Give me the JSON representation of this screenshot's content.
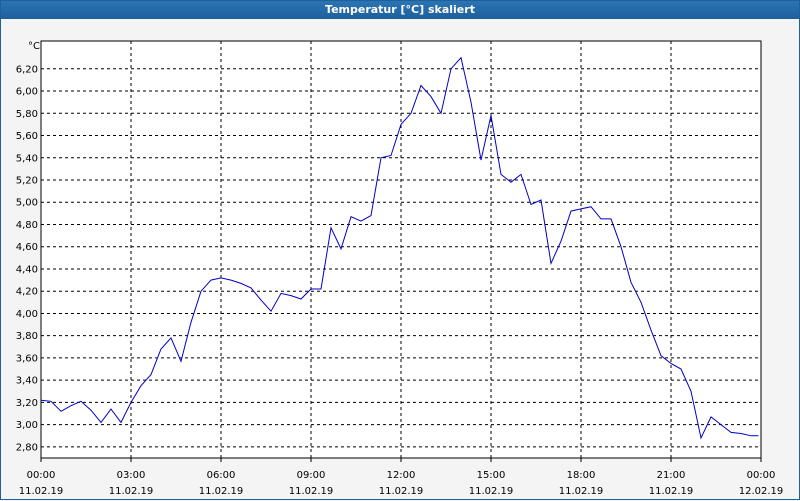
{
  "window": {
    "title": "Temperatur [°C] skaliert"
  },
  "chart_data": {
    "type": "line",
    "title": "Temperatur [°C] skaliert",
    "ylabel": "°C",
    "xlabel": "",
    "ylim": [
      2.7,
      6.45
    ],
    "xlim_hours": [
      0,
      24
    ],
    "grid": true,
    "grid_style": "dashed",
    "y_ticks": [
      "2,80",
      "3,00",
      "3,20",
      "3,40",
      "3,60",
      "3,80",
      "4,00",
      "4,20",
      "4,40",
      "4,60",
      "4,80",
      "5,00",
      "5,20",
      "5,40",
      "5,60",
      "5,80",
      "6,00",
      "6,20"
    ],
    "x_ticks": [
      {
        "time": "00:00",
        "date": "11.02.19"
      },
      {
        "time": "03:00",
        "date": "11.02.19"
      },
      {
        "time": "06:00",
        "date": "11.02.19"
      },
      {
        "time": "09:00",
        "date": "11.02.19"
      },
      {
        "time": "12:00",
        "date": "11.02.19"
      },
      {
        "time": "15:00",
        "date": "11.02.19"
      },
      {
        "time": "18:00",
        "date": "11.02.19"
      },
      {
        "time": "21:00",
        "date": "11.02.19"
      },
      {
        "time": "00:00",
        "date": "12.02.19"
      }
    ],
    "series": [
      {
        "color": "#0000c8",
        "x": [
          "11.02.19 00:00",
          "11.02.19 00:20",
          "11.02.19 00:40",
          "11.02.19 01:00",
          "11.02.19 01:20",
          "11.02.19 01:40",
          "11.02.19 02:00",
          "11.02.19 02:20",
          "11.02.19 02:40",
          "11.02.19 03:00",
          "11.02.19 03:20",
          "11.02.19 03:40",
          "11.02.19 04:00",
          "11.02.19 04:20",
          "11.02.19 04:40",
          "11.02.19 05:00",
          "11.02.19 05:20",
          "11.02.19 05:40",
          "11.02.19 06:00",
          "11.02.19 06:20",
          "11.02.19 06:40",
          "11.02.19 07:00",
          "11.02.19 07:20",
          "11.02.19 07:40",
          "11.02.19 08:00",
          "11.02.19 08:20",
          "11.02.19 08:40",
          "11.02.19 09:00",
          "11.02.19 09:20",
          "11.02.19 09:40",
          "11.02.19 10:00",
          "11.02.19 10:20",
          "11.02.19 10:40",
          "11.02.19 11:00",
          "11.02.19 11:20",
          "11.02.19 11:40",
          "11.02.19 12:00",
          "11.02.19 12:20",
          "11.02.19 12:40",
          "11.02.19 13:00",
          "11.02.19 13:20",
          "11.02.19 13:40",
          "11.02.19 14:00",
          "11.02.19 14:20",
          "11.02.19 14:40",
          "11.02.19 15:00",
          "11.02.19 15:20",
          "11.02.19 15:40",
          "11.02.19 16:00",
          "11.02.19 16:20",
          "11.02.19 16:40",
          "11.02.19 17:00",
          "11.02.19 17:20",
          "11.02.19 17:40",
          "11.02.19 18:00",
          "11.02.19 18:20",
          "11.02.19 18:40",
          "11.02.19 19:00",
          "11.02.19 19:20",
          "11.02.19 19:40",
          "11.02.19 20:00",
          "11.02.19 20:20",
          "11.02.19 20:40",
          "11.02.19 21:00",
          "11.02.19 21:20",
          "11.02.19 21:40",
          "11.02.19 22:00",
          "11.02.19 22:20",
          "11.02.19 22:40",
          "11.02.19 23:00",
          "11.02.19 23:20",
          "11.02.19 23:40",
          "11.02.19 23:55"
        ],
        "y": [
          3.22,
          3.21,
          3.12,
          3.17,
          3.21,
          3.13,
          3.02,
          3.14,
          3.02,
          3.2,
          3.35,
          3.45,
          3.68,
          3.78,
          3.57,
          3.92,
          4.2,
          4.3,
          4.32,
          4.3,
          4.27,
          4.23,
          4.12,
          4.02,
          4.18,
          4.16,
          4.13,
          4.22,
          4.22,
          4.77,
          4.58,
          4.87,
          4.83,
          4.88,
          5.4,
          5.42,
          5.7,
          5.8,
          6.05,
          5.95,
          5.8,
          6.2,
          6.3,
          5.9,
          5.38,
          5.78,
          5.25,
          5.18,
          5.25,
          4.98,
          5.02,
          4.45,
          4.65,
          4.92,
          4.94,
          4.96,
          4.85,
          4.85,
          4.6,
          4.28,
          4.1,
          3.85,
          3.62,
          3.55,
          3.5,
          3.3,
          2.88,
          3.07,
          3.0,
          2.93,
          2.92,
          2.9,
          2.9
        ]
      }
    ]
  }
}
